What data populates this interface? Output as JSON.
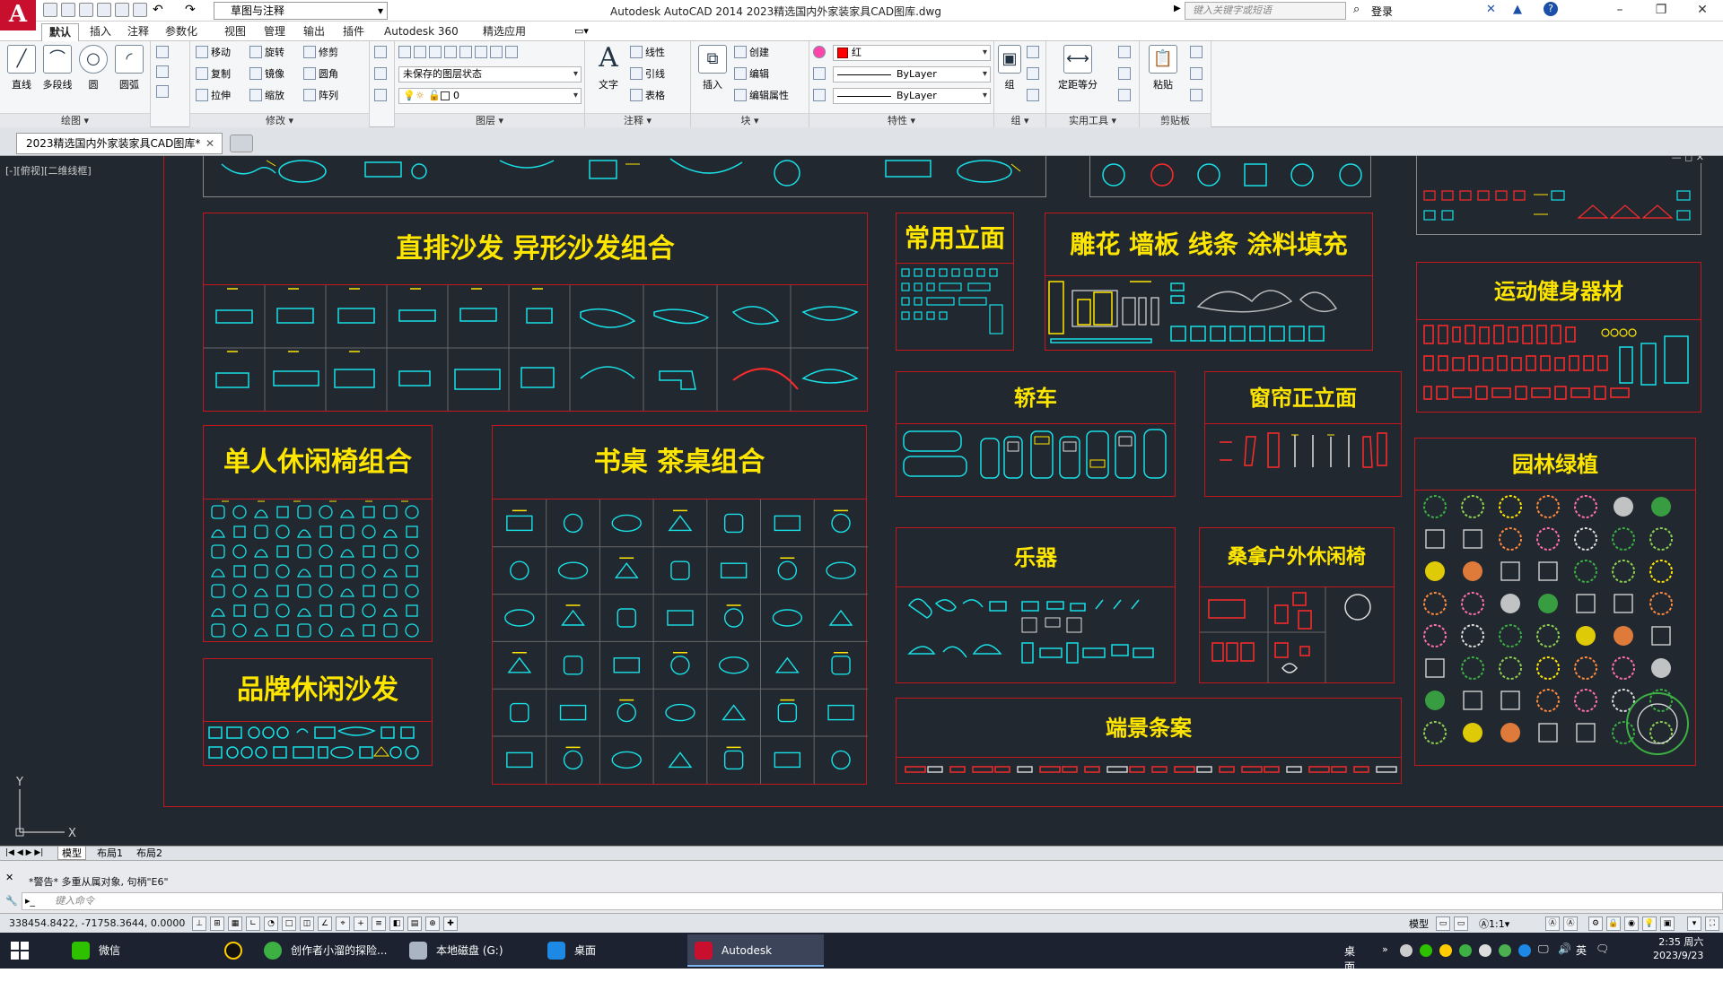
{
  "title_bar": {
    "app_letter": "A",
    "workspace": "草图与注释",
    "window_title": "Autodesk AutoCAD 2014    2023精选国内外家装家具CAD图库.dwg",
    "search_placeholder": "键入关键字或短语",
    "login": "登录"
  },
  "ribbon_tabs": [
    "默认",
    "插入",
    "注释",
    "参数化",
    "视图",
    "管理",
    "输出",
    "插件",
    "Autodesk 360",
    "精选应用"
  ],
  "ribbon": {
    "draw": {
      "title": "绘图 ▾",
      "tools": [
        "直线",
        "多段线",
        "圆",
        "圆弧"
      ]
    },
    "modify": {
      "title": "修改 ▾",
      "tools": [
        "移动",
        "旋转",
        "修剪",
        "复制",
        "镜像",
        "圆角",
        "拉伸",
        "缩放",
        "阵列"
      ]
    },
    "layers": {
      "title": "图层 ▾",
      "state": "未保存的图层状态",
      "current": "0"
    },
    "annotation": {
      "title": "注释 ▾",
      "text": "文字",
      "tools": [
        "线性",
        "引线",
        "表格"
      ]
    },
    "block": {
      "title": "块 ▾",
      "insert": "插入",
      "tools": [
        "创建",
        "编辑",
        "编辑属性"
      ]
    },
    "properties": {
      "title": "特性 ▾",
      "color": "红",
      "linetype": "ByLayer",
      "lineweight": "ByLayer"
    },
    "groups": {
      "title": "组 ▾",
      "label": "组"
    },
    "utilities": {
      "title": "实用工具 ▾",
      "label": "定距等分"
    },
    "clipboard": {
      "title": "剪贴板",
      "label": "粘贴"
    }
  },
  "file_tab": "2023精选国内外家装家具CAD图库*",
  "viewport_label": "[-][俯视][二维线框]",
  "sections": {
    "sofa": "直排沙发   异形沙发组合",
    "elev": "常用立面",
    "carve": "雕花  墙板  线条  涂料填充",
    "fitness": "运动健身器材",
    "car": "轿车",
    "curtain": "窗帘正立面",
    "chair": "单人休闲椅组合",
    "desk": "书桌  茶桌组合",
    "instrument": "乐器",
    "sauna": "桑拿户外休闲椅",
    "garden": "园林绿植",
    "brand": "品牌休闲沙发",
    "console": "端景条案"
  },
  "layout_tabs": [
    "模型",
    "布局1",
    "布局2"
  ],
  "command": {
    "output": "*警告* 多重从属对象, 句柄\"E6\"",
    "placeholder": "键入命令"
  },
  "status": {
    "coords": "338454.8422, -71758.3644, 0.0000",
    "model": "模型",
    "scale": "1:1"
  },
  "taskbar": {
    "items": [
      "微信",
      "创作者小溜的探险...",
      "本地磁盘 (G:)",
      "桌面",
      "Autodesk AutoCA..."
    ],
    "tray_label": "桌面",
    "ime": "英",
    "time": "2:35 周六",
    "date": "2023/9/23"
  },
  "colors": {
    "accent": "#c8102e",
    "cad_bg": "#212830",
    "frame": "#c4161c",
    "heading": "#ffe600",
    "cyan": "#19e0e6"
  }
}
